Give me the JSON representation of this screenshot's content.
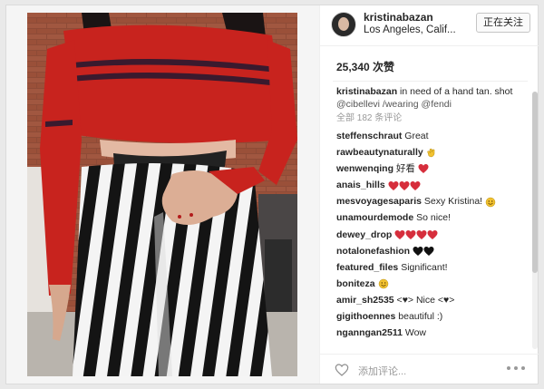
{
  "post": {
    "username": "kristinabazan",
    "location": "Los Angeles, Calif...",
    "follow_label": "正在关注",
    "likes": "25,340 次赞",
    "caption_user": "kristinabazan",
    "caption_text": "in need of a hand tan. shot",
    "caption_line2": "@cibellevi /wearing @fendi",
    "all_comments": "全部 182 条评论",
    "comments": [
      {
        "user": "steffenschraut",
        "text": "Great",
        "emoji": []
      },
      {
        "user": "rawbeautynaturally",
        "text": "",
        "emoji": [
          "clap"
        ]
      },
      {
        "user": "wenwenqing",
        "text": "好看",
        "emoji": [
          "heart"
        ]
      },
      {
        "user": "anais_hills",
        "text": "",
        "emoji": [
          "heart",
          "heart",
          "heart"
        ]
      },
      {
        "user": "mesvoyagesaparis",
        "text": "Sexy Kristina!",
        "emoji": [
          "smile"
        ]
      },
      {
        "user": "unamourdemode",
        "text": "So nice!",
        "emoji": []
      },
      {
        "user": "dewey_drop",
        "text": "",
        "emoji": [
          "heart",
          "heart",
          "heart",
          "heart"
        ]
      },
      {
        "user": "notalonefashion",
        "text": "",
        "emoji": [
          "black-heart",
          "black-heart"
        ]
      },
      {
        "user": "featured_files",
        "text": "Significant!",
        "emoji": []
      },
      {
        "user": "boniteza",
        "text": "",
        "emoji": [
          "smile"
        ]
      },
      {
        "user": "amir_sh2535",
        "text": "<♥> Nice  <♥>",
        "emoji": []
      },
      {
        "user": "gigithoennes",
        "text": "beautiful :)",
        "emoji": []
      },
      {
        "user": "nganngan2511",
        "text": "Wow",
        "emoji": []
      }
    ],
    "add_comment_placeholder": "添加评论..."
  },
  "colors": {
    "heart": "#d62e3c",
    "emoji_yellow": "#f2c230",
    "link": "#555555"
  },
  "icons": {
    "like": "heart-outline-icon",
    "more": "more-dots-icon"
  }
}
